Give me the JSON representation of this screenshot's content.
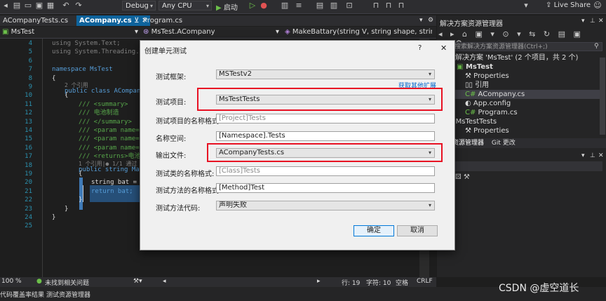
{
  "toolbar": {
    "config_label": "Debug",
    "platform_label": "Any CPU",
    "start_label": "启动",
    "live_share_label": "Live Share"
  },
  "editor_tabs": [
    {
      "label": "ACompanyTests.cs"
    },
    {
      "label": "ACompany.cs"
    },
    {
      "label": "Program.cs"
    }
  ],
  "navbar": {
    "project": "MsTest",
    "class": "MsTest.ACompany",
    "member": "MakeBattary(string V, string shape, string ty"
  },
  "code": {
    "line_numbers": [
      "4",
      "5",
      "6",
      "7",
      "8",
      "9",
      "10",
      "11",
      "12",
      "13",
      "14",
      "15",
      "16",
      "17",
      "18",
      "19",
      "20",
      "21",
      "22",
      "23",
      "24",
      "25"
    ],
    "line4": "using System.Text;",
    "line5": "using System.Threading.Tasks;",
    "line7": "namespace MsTest",
    "line8": "{",
    "refs_class": "2 个引用",
    "line9": "public class ACompany",
    "line10": "{",
    "line11": "/// <summary>",
    "line12": "/// 电池制造",
    "line13": "/// </summary>",
    "line14": "/// <param name=\"V\"",
    "line15": "/// <param name=\"sh",
    "line16": "/// <param name=\"ty",
    "line17": "/// <returns>电池<",
    "refs_method": "1 个引用|● 1/1 通过",
    "line18": "public string MakeB",
    "line19": "{",
    "line20": "string bat = \"",
    "line21": "return bat;",
    "line22": "}",
    "line23": "}",
    "line24": "}"
  },
  "solution_explorer": {
    "title": "解决方案资源管理器",
    "search_placeholder": "搜索解决方案资源管理器(Ctrl+;)",
    "solution_label": "解决方案 'MsTest' (2 个项目，共 2 个)",
    "items": [
      {
        "label": "MsTest"
      },
      {
        "label": "Properties"
      },
      {
        "label": "引用"
      },
      {
        "label": "ACompany.cs"
      },
      {
        "label": "App.config"
      },
      {
        "label": "Program.cs"
      },
      {
        "label": "MsTestTests"
      },
      {
        "label": "Properties"
      }
    ],
    "bottom_tabs": [
      "方案资源管理器",
      "Git 更改"
    ]
  },
  "dialog": {
    "title": "创建单元测试",
    "help": "?",
    "close": "✕",
    "get_more": "获取其他扩展",
    "fields": [
      {
        "label": "测试框架:",
        "value": "MSTestv2"
      },
      {
        "label": "测试项目:",
        "value": "MsTestTests"
      },
      {
        "label": "测试项目的名称格式:",
        "value": "[Project]Tests"
      },
      {
        "label": "名称空间:",
        "value": "[Namespace].Tests"
      },
      {
        "label": "输出文件:",
        "value": "ACompanyTests.cs"
      },
      {
        "label": "测试类的名称格式:",
        "value": "[Class]Tests"
      },
      {
        "label": "测试方法的名称格式:",
        "value": "[Method]Test"
      },
      {
        "label": "测试方法代码:",
        "value": "声明失败"
      }
    ],
    "ok_label": "确定",
    "cancel_label": "取消"
  },
  "statusbar": {
    "zoom": "100 %",
    "issues": "未找到相关问题",
    "line": "行: 19",
    "col": "字符: 10",
    "space": "空格",
    "eol": "CRLF"
  },
  "bottom_tabs": [
    "代码覆盖率结果",
    "测试资源管理器"
  ],
  "watermark": "CSDN @虚空道长",
  "colors": {
    "accent": "#0e639c",
    "highlight": "#e81123"
  }
}
